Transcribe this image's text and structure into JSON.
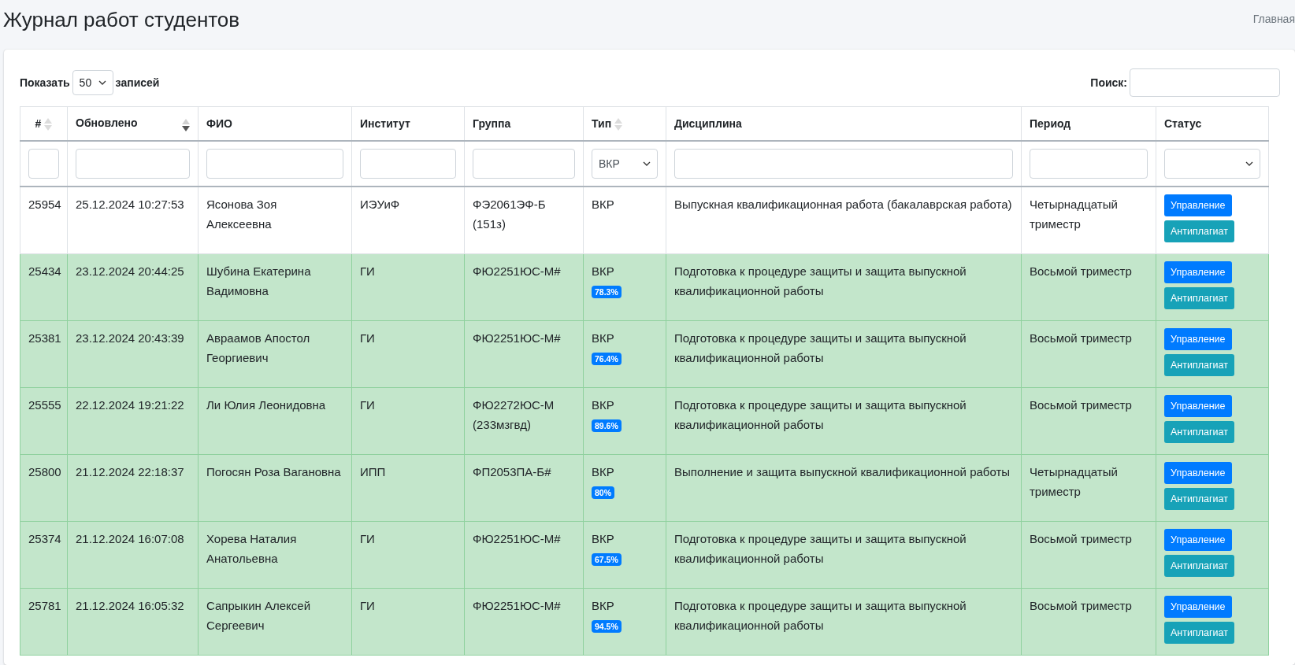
{
  "page": {
    "title": "Журнал работ студентов",
    "breadcrumb": "Главная"
  },
  "length": {
    "label_before": "Показать",
    "value": "50",
    "label_after": "записей"
  },
  "search": {
    "label": "Поиск:"
  },
  "columns": [
    {
      "label": "#",
      "sortable": true,
      "sorted": false
    },
    {
      "label": "Обновлено",
      "sortable": true,
      "sorted": true
    },
    {
      "label": "ФИО",
      "sortable": false
    },
    {
      "label": "Институт",
      "sortable": false
    },
    {
      "label": "Группа",
      "sortable": false
    },
    {
      "label": "Тип",
      "sortable": true,
      "sorted": false
    },
    {
      "label": "Дисциплина",
      "sortable": false
    },
    {
      "label": "Период",
      "sortable": false
    },
    {
      "label": "Статус",
      "sortable": false
    }
  ],
  "filters": [
    {
      "kind": "input"
    },
    {
      "kind": "input"
    },
    {
      "kind": "input"
    },
    {
      "kind": "input"
    },
    {
      "kind": "input"
    },
    {
      "kind": "select",
      "value": "ВКР"
    },
    {
      "kind": "input"
    },
    {
      "kind": "input"
    },
    {
      "kind": "select"
    }
  ],
  "rows": [
    {
      "highlighted": false,
      "id": "25954",
      "updated": "25.12.2024 10:27:53",
      "name": "Ясонова Зоя Алексеевна",
      "institute": "ИЭУиФ",
      "group": "ФЭ2061ЭФ-Б (151з)",
      "type": "ВКР",
      "discipline": "Выпускная квалификационная работа (бакалаврская работа)",
      "period": "Четырнадцатый триместр",
      "actions": [
        "Управление",
        "Антиплагиат"
      ]
    },
    {
      "highlighted": true,
      "id": "25434",
      "updated": "23.12.2024 20:44:25",
      "name": "Шубина Екатерина Вадимовна",
      "institute": "ГИ",
      "group": "ФЮ2251ЮС-М#",
      "type": "ВКР",
      "badge": "78.3%",
      "discipline": "Подготовка к процедуре защиты и защита выпускной квалификационной работы",
      "period": "Восьмой триместр",
      "actions": [
        "Управление",
        "Антиплагиат"
      ]
    },
    {
      "highlighted": true,
      "id": "25381",
      "updated": "23.12.2024 20:43:39",
      "name": "Авраамов Апостол Георгиевич",
      "institute": "ГИ",
      "group": "ФЮ2251ЮС-М#",
      "type": "ВКР",
      "badge": "76.4%",
      "discipline": "Подготовка к процедуре защиты и защита выпускной квалификационной работы",
      "period": "Восьмой триместр",
      "actions": [
        "Управление",
        "Антиплагиат"
      ]
    },
    {
      "highlighted": true,
      "id": "25555",
      "updated": "22.12.2024 19:21:22",
      "name": "Ли Юлия Леонидовна",
      "institute": "ГИ",
      "group": "ФЮ2272ЮС-М (233мзгвд)",
      "type": "ВКР",
      "badge": "89.6%",
      "discipline": "Подготовка к процедуре защиты и защита выпускной квалификационной работы",
      "period": "Восьмой триместр",
      "actions": [
        "Управление",
        "Антиплагиат"
      ]
    },
    {
      "highlighted": true,
      "id": "25800",
      "updated": "21.12.2024 22:18:37",
      "name": "Погосян Роза Вагановна",
      "institute": "ИПП",
      "group": "ФП2053ПА-Б#",
      "type": "ВКР",
      "badge": "80%",
      "discipline": "Выполнение и защита выпускной квалификационной работы",
      "period": "Четырнадцатый триместр",
      "actions": [
        "Управление",
        "Антиплагиат"
      ]
    },
    {
      "highlighted": true,
      "id": "25374",
      "updated": "21.12.2024 16:07:08",
      "name": "Хорева Наталия Анатольевна",
      "institute": "ГИ",
      "group": "ФЮ2251ЮС-М#",
      "type": "ВКР",
      "badge": "67.5%",
      "discipline": "Подготовка к процедуре защиты и защита выпускной квалификационной работы",
      "period": "Восьмой триместр",
      "actions": [
        "Управление",
        "Антиплагиат"
      ]
    },
    {
      "highlighted": true,
      "id": "25781",
      "updated": "21.12.2024 16:05:32",
      "name": "Сапрыкин Алексей Сергеевич",
      "institute": "ГИ",
      "group": "ФЮ2251ЮС-М#",
      "type": "ВКР",
      "badge": "94.5%",
      "discipline": "Подготовка к процедуре защиты и защита выпускной квалификационной работы",
      "period": "Восьмой триместр",
      "actions": [
        "Управление",
        "Антиплагиат"
      ]
    }
  ]
}
